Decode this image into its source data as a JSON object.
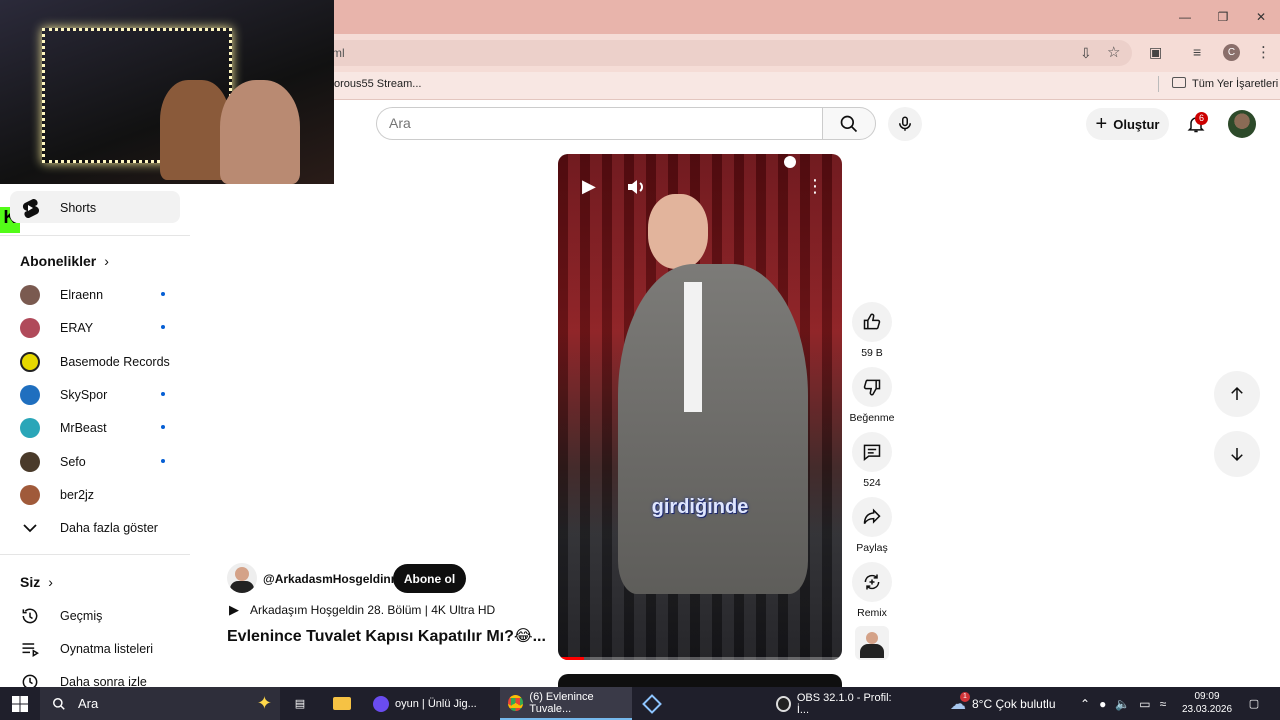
{
  "browser": {
    "url_fragment": "ml",
    "bookmark_item": "orous55 Stream...",
    "all_bookmarks": "Tüm Yer İşaretleri",
    "profile_initial": "C"
  },
  "header": {
    "search_placeholder": "Ara",
    "create_label": "Oluştur",
    "notification_count": "6"
  },
  "sidebar": {
    "shorts_label": "Shorts",
    "subscriptions_title": "Abonelikler",
    "channels": [
      {
        "name": "Elraenn",
        "color": "#7a5a50",
        "new": true
      },
      {
        "name": "ERAY",
        "color": "#b04a5a",
        "new": true
      },
      {
        "name": "Basemode Records",
        "color": "#e6d800",
        "new": false
      },
      {
        "name": "SkySpor",
        "color": "#1f6fbf",
        "new": true
      },
      {
        "name": "MrBeast",
        "color": "#2aa6b8",
        "new": true
      },
      {
        "name": "Sefo",
        "color": "#4a3a2a",
        "new": true
      },
      {
        "name": "ber2jz",
        "color": "#a05a3a",
        "new": false
      }
    ],
    "show_more": "Daha fazla göster",
    "you_title": "Siz",
    "you_items": [
      {
        "label": "Geçmiş",
        "icon": "history-icon"
      },
      {
        "label": "Oynatma listeleri",
        "icon": "playlist-icon"
      },
      {
        "label": "Daha sonra izle",
        "icon": "watch-later-icon"
      }
    ]
  },
  "video": {
    "caption": "girdiğinde",
    "progress": 0.09,
    "channel_handle": "@ArkadasmHosgeldinn",
    "subscribe_label": "Abone ol",
    "playlist_title": "Arkadaşım Hoşgeldin 28. Bölüm | 4K Ultra HD",
    "title": "Evlenince Tuvalet Kapısı Kapatılır Mı?😂..."
  },
  "actions": {
    "likes": "59 B",
    "dislike_label": "Beğenme",
    "comments": "524",
    "share_label": "Paylaş",
    "remix_label": "Remix"
  },
  "taskbar": {
    "search_label": "Ara",
    "apps": [
      {
        "label": "oyun | Ünlü Jig...",
        "active": false
      },
      {
        "label": "(6) Evlenince Tuvale...",
        "active": true
      },
      {
        "label": "OBS 32.1.0 - Profil: İ...",
        "active": false
      }
    ],
    "weather": "8°C  Çok bulutlu",
    "time": "09:09",
    "date": "23.03.2026",
    "weather_badge": "1"
  }
}
